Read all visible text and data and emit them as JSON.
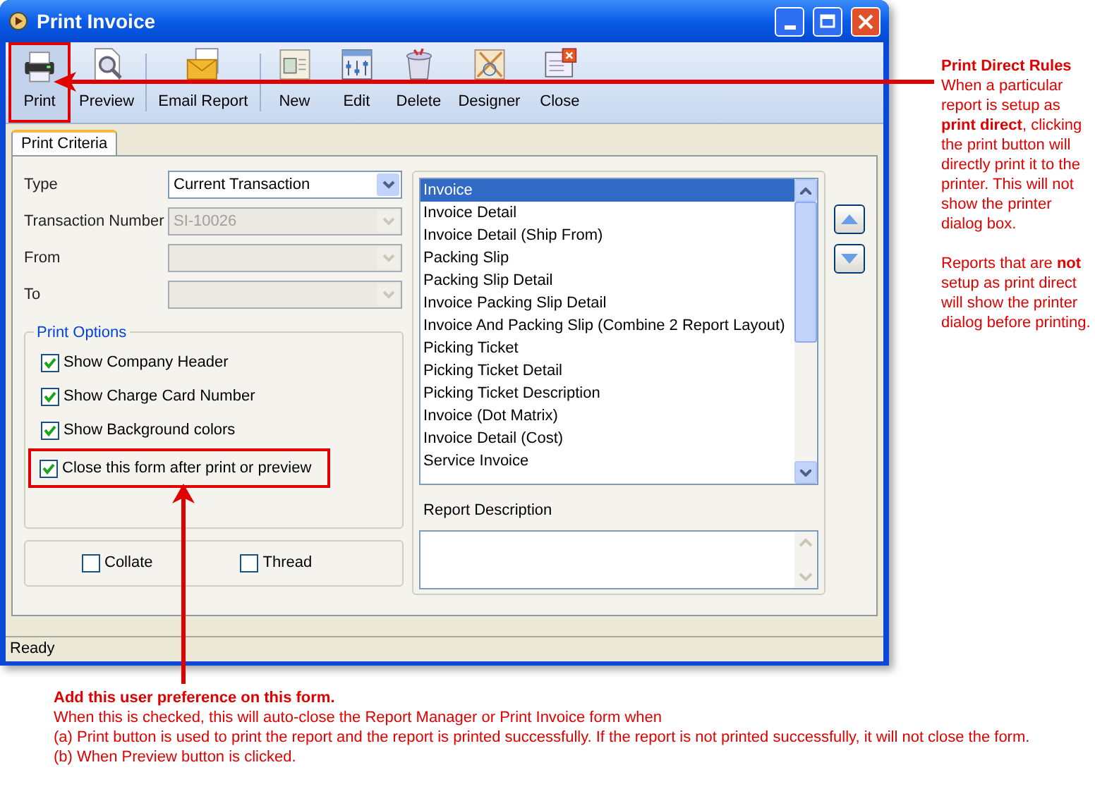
{
  "window": {
    "title": "Print Invoice"
  },
  "toolbar": {
    "buttons": [
      {
        "label": "Print",
        "kind": "print",
        "highlighted": true
      },
      {
        "label": "Preview",
        "kind": "preview",
        "highlighted": false
      },
      {
        "label": "Email Report",
        "kind": "email",
        "highlighted": false
      },
      {
        "label": "New",
        "kind": "new",
        "highlighted": false
      },
      {
        "label": "Edit",
        "kind": "edit",
        "highlighted": false
      },
      {
        "label": "Delete",
        "kind": "delete",
        "highlighted": false
      },
      {
        "label": "Designer",
        "kind": "designer",
        "highlighted": false
      },
      {
        "label": "Close",
        "kind": "close",
        "highlighted": false
      }
    ]
  },
  "tabs": [
    {
      "label": "Print Criteria",
      "selected": true
    }
  ],
  "fields": [
    {
      "label": "Type",
      "value": "Current Transaction",
      "disabled": false
    },
    {
      "label": "Transaction Number",
      "value": "SI-10026",
      "disabled": true
    },
    {
      "label": "From",
      "disabled": true
    },
    {
      "label": "To",
      "disabled": true
    }
  ],
  "print_options": {
    "title": "Print Options",
    "options": [
      {
        "label": "Show Company Header",
        "checked": true,
        "highlighted": false
      },
      {
        "label": "Show Charge Card Number",
        "checked": true,
        "highlighted": false
      },
      {
        "label": "Show Background colors",
        "checked": true,
        "highlighted": false
      },
      {
        "label": "Close this form after print or preview",
        "checked": true,
        "highlighted": true
      }
    ]
  },
  "extra_options": [
    {
      "label": "Collate",
      "checked": false
    },
    {
      "label": "Thread",
      "checked": false
    }
  ],
  "report_list": {
    "items": [
      {
        "label": "Invoice",
        "selected": true
      },
      {
        "label": "Invoice Detail",
        "selected": false
      },
      {
        "label": "Invoice Detail (Ship From)",
        "selected": false
      },
      {
        "label": "Packing Slip",
        "selected": false
      },
      {
        "label": "Packing Slip Detail",
        "selected": false
      },
      {
        "label": "Invoice Packing Slip Detail",
        "selected": false
      },
      {
        "label": "Invoice And Packing Slip (Combine 2 Report Layout)",
        "selected": false
      },
      {
        "label": "Picking Ticket",
        "selected": false
      },
      {
        "label": "Picking Ticket Detail",
        "selected": false
      },
      {
        "label": "Picking Ticket Description",
        "selected": false
      },
      {
        "label": "Invoice (Dot Matrix)",
        "selected": false
      },
      {
        "label": "Invoice Detail (Cost)",
        "selected": false
      },
      {
        "label": "Service Invoice",
        "selected": false
      }
    ]
  },
  "report_description": {
    "label": "Report Description"
  },
  "status_bar": {
    "text": "Ready"
  },
  "annotations": [
    {
      "title": "Print Direct Rules",
      "paragraphs": [
        "When a particular report is setup as **print direct**, clicking the print button will directly print it to the printer. This will not show the printer dialog box.",
        "Reports that are **not** setup as print direct will show the printer dialog before printing."
      ]
    },
    {
      "title": "Add this user preference on this form.",
      "paragraphs": [
        "When this is checked, this will auto-close the Report Manager or Print Invoice form when",
        "(a) Print button is used to print the report and the report is printed successfully. If the report is not printed successfully, it will not close the form.",
        "(b) When Preview button is clicked."
      ]
    }
  ]
}
